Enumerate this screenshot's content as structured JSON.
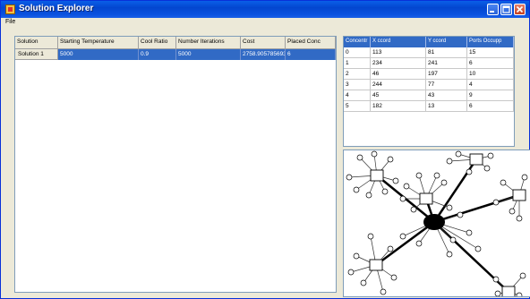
{
  "window": {
    "title": "Solution Explorer"
  },
  "menu": {
    "file": "File"
  },
  "solutions_grid": {
    "columns": [
      "Solution",
      "Starting Temperature",
      "Cool Ratio",
      "Number Iterations",
      "Cost",
      "Placed Conc"
    ],
    "rows": [
      {
        "name": "Solution 1",
        "starting_temperature": "5000",
        "cool_ratio": "0.9",
        "iterations": "5000",
        "cost": "2758.905785693",
        "placed": "6"
      }
    ]
  },
  "concentrators_grid": {
    "columns": [
      "Concentr",
      "X ccord",
      "Y ccord",
      "Ports Occupp"
    ],
    "rows": [
      [
        "0",
        "113",
        "81",
        "15"
      ],
      [
        "1",
        "234",
        "241",
        "6"
      ],
      [
        "2",
        "46",
        "197",
        "10"
      ],
      [
        "3",
        "244",
        "77",
        "4"
      ],
      [
        "4",
        "45",
        "43",
        "9"
      ],
      [
        "5",
        "182",
        "13",
        "6"
      ]
    ]
  },
  "network": {
    "concentrator_count": 6,
    "terminal_count": 50
  }
}
